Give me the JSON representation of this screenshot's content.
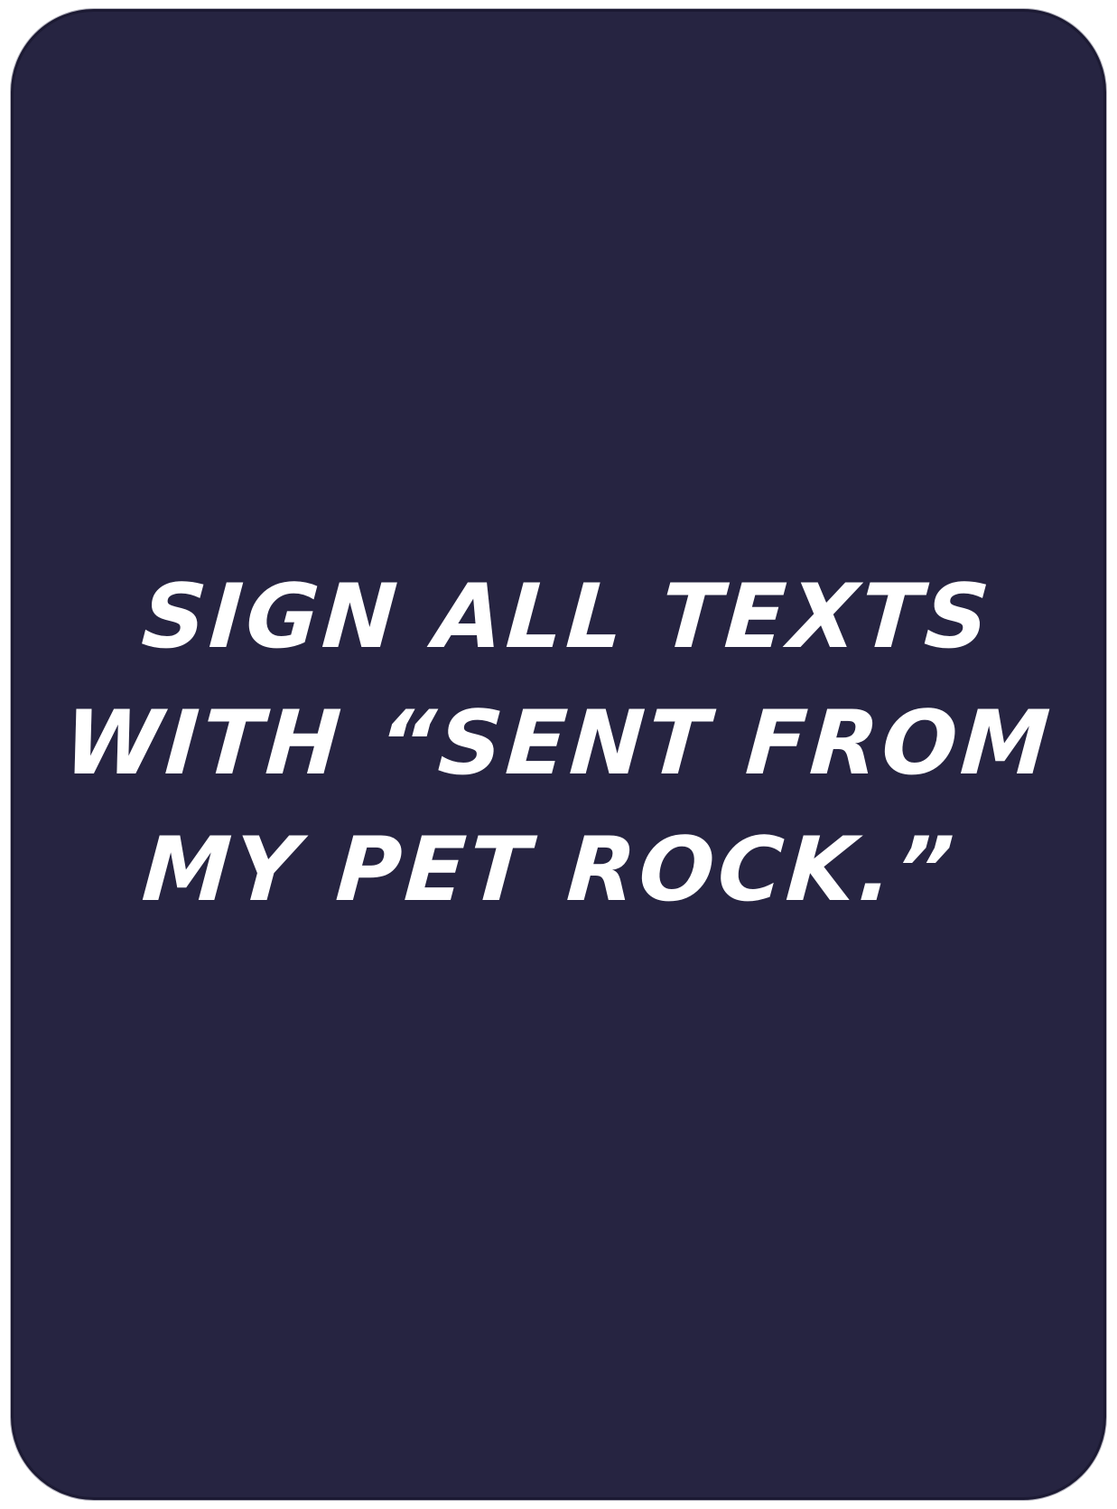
{
  "card": {
    "background_color": "#262441",
    "text_color": "#ffffff",
    "lines": [
      "SIGN ALL TEXTS",
      "WITH “SENT FROM",
      "MY PET ROCK.”"
    ]
  }
}
